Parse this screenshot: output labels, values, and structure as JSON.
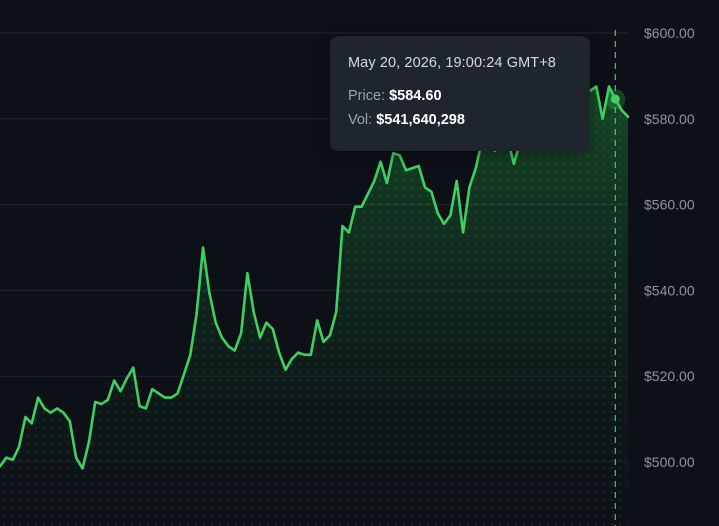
{
  "colors": {
    "background": "#0d1117",
    "line": "#3fd061",
    "grid": "#21272e",
    "axis_text": "#8b97a6",
    "crosshair": "#3fd061",
    "tooltip_bg": "#1f252d"
  },
  "tooltip": {
    "time": "May 20, 2026, 19:00:24 GMT+8",
    "price_label": "Price:",
    "price_value": "$584.60",
    "vol_label": "Vol:",
    "vol_value": "$541,640,298"
  },
  "chart_data": {
    "type": "area",
    "y_ticks": [
      {
        "value": 600,
        "label": "$600.00"
      },
      {
        "value": 580,
        "label": "$580.00"
      },
      {
        "value": 560,
        "label": "$560.00"
      },
      {
        "value": 540,
        "label": "$540.00"
      },
      {
        "value": 520,
        "label": "$520.00"
      },
      {
        "value": 500,
        "label": "$500.00"
      }
    ],
    "y_axis_position": "right",
    "grid": true,
    "values": [
      499.0,
      501.0,
      500.5,
      503.5,
      510.5,
      509.0,
      515.0,
      512.5,
      511.5,
      512.5,
      511.5,
      509.5,
      501.0,
      498.5,
      504.5,
      514.0,
      513.5,
      514.5,
      519.0,
      516.5,
      519.5,
      522.0,
      513.0,
      512.5,
      517.0,
      516.0,
      515.0,
      515.0,
      516.0,
      520.5,
      525.0,
      534.5,
      550.0,
      539.5,
      532.5,
      529.0,
      527.0,
      526.0,
      530.0,
      544.0,
      535.0,
      529.0,
      532.5,
      531.0,
      525.5,
      521.5,
      524.0,
      525.5,
      525.0,
      525.0,
      533.0,
      528.0,
      529.5,
      535.0,
      555.0,
      553.5,
      559.5,
      559.5,
      562.5,
      565.5,
      570.0,
      565.0,
      572.0,
      571.5,
      568.0,
      568.5,
      569.0,
      564.0,
      563.0,
      558.0,
      555.5,
      557.5,
      565.5,
      553.5,
      564.0,
      568.5,
      575.0,
      578.0,
      572.5,
      575.0,
      575.5,
      569.5,
      574.5,
      576.5,
      580.5,
      579.0,
      582.5,
      584.0,
      581.0,
      579.5,
      583.0,
      586.5,
      587.0,
      586.5,
      587.5,
      580.0,
      587.5,
      584.6,
      582.0,
      580.5
    ],
    "highlight_index": 97
  }
}
